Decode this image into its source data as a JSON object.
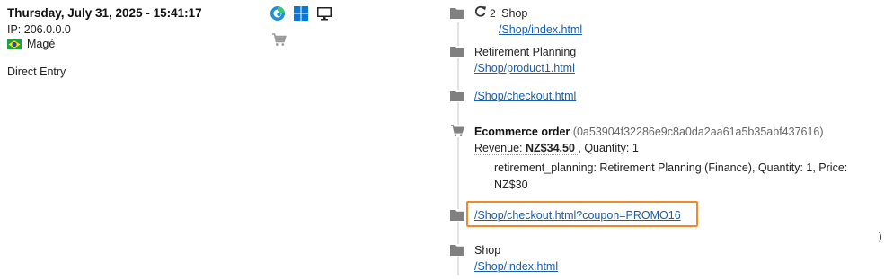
{
  "visit": {
    "datetime": "Thursday, July 31, 2025 - 15:41:17",
    "ip": "IP: 206.0.0.0",
    "city": "Magé",
    "referrer": "Direct Entry"
  },
  "icons": {
    "browser": "edge-browser-icon",
    "os": "windows-icon",
    "device": "desktop-icon",
    "ecommerce": "cart-icon"
  },
  "timeline": {
    "entries": [
      {
        "type": "page",
        "icon": "folder-icon",
        "repeat_icon": "refresh-icon",
        "repeat_count": "2",
        "title": "Shop",
        "url": "/Shop/index.html"
      },
      {
        "type": "page",
        "icon": "folder-icon",
        "title": "Retirement Planning",
        "url": "/Shop/product1.html"
      },
      {
        "type": "page",
        "icon": "folder-icon",
        "url": "/Shop/checkout.html"
      },
      {
        "type": "ecommerce",
        "icon": "cart-icon",
        "title": "Ecommerce order",
        "order_id": "(0a53904f32286e9c8a0da2aa61a5b35abf437616)",
        "revenue_label": "Revenue:",
        "revenue_value": "NZ$34.50",
        "quantity_text": ", Quantity: 1",
        "item_line": "retirement_planning: Retirement Planning (Finance), Quantity: 1, Price:",
        "item_price": "NZ$30"
      },
      {
        "type": "page",
        "icon": "folder-icon",
        "url": "/Shop/checkout.html?coupon=PROMO16",
        "highlighted": true
      },
      {
        "type": "page",
        "icon": "folder-icon",
        "title": "Shop",
        "url": "/Shop/index.html"
      }
    ]
  },
  "stray_char": ")",
  "colors": {
    "link": "#1a5ea8",
    "highlight_border": "#ee8a2a"
  }
}
